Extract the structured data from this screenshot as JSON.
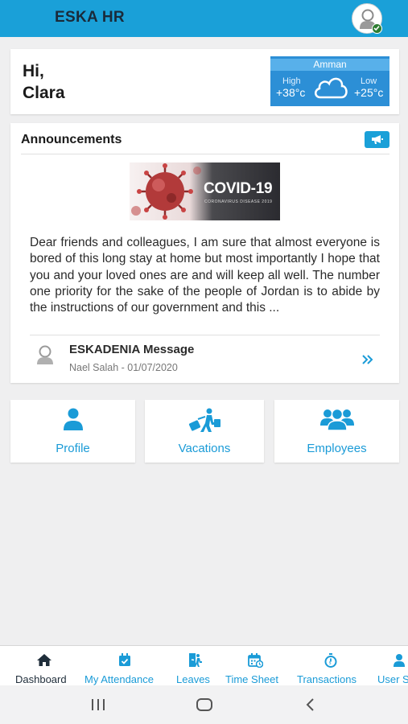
{
  "app": {
    "title": "ESKA HR"
  },
  "header": {
    "avatar_icon": "user-avatar-icon",
    "status_icon": "check-icon",
    "status_color": "#2e7d32"
  },
  "greeting": {
    "line1": "Hi,",
    "line2": "Clara"
  },
  "weather": {
    "city": "Amman",
    "high_label": "High",
    "high_value": "+38°c",
    "low_label": "Low",
    "low_value": "+25°c",
    "icon": "cloud-icon"
  },
  "announcements": {
    "title": "Announcements",
    "image_text": "COVID-19",
    "image_subtext": "CORONAVIRUS DISEASE 2019",
    "body": "Dear friends and colleagues, I am sure that almost everyone is bored of this long stay at home but most importantly I hope that you and your loved ones are and will keep all well. The number one priority for the sake of the people of Jordan is to abide by the instructions of our government and this ...",
    "message_title": "ESKADENIA Message",
    "message_meta": "Nael Salah - 01/07/2020"
  },
  "tiles": [
    {
      "label": "Profile",
      "icon": "person-icon"
    },
    {
      "label": "Vacations",
      "icon": "traveler-icon"
    },
    {
      "label": "Employees",
      "icon": "group-icon"
    }
  ],
  "bottom_nav": [
    {
      "label": "Dashboard",
      "icon": "home-icon"
    },
    {
      "label": "My Attendance",
      "icon": "calendar-check-icon"
    },
    {
      "label": "Leaves",
      "icon": "walking-exit-icon"
    },
    {
      "label": "Time Sheet",
      "icon": "calendar-grid-icon"
    },
    {
      "label": "Transactions",
      "icon": "stopwatch-icon"
    },
    {
      "label": "User S",
      "icon": "user-settings-icon"
    }
  ],
  "colors": {
    "primary": "#1aa0d8",
    "accent_text": "#1a9bd7",
    "weather_bg": "#2c8fd6",
    "background": "#efeff0"
  }
}
